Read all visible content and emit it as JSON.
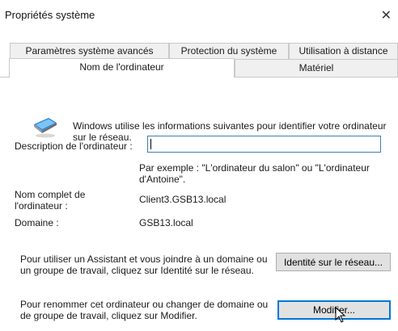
{
  "window": {
    "title": "Propriétés système",
    "close_glyph": "✕"
  },
  "tabs": {
    "row1": [
      "Paramètres système avancés",
      "Protection du système",
      "Utilisation à distance"
    ],
    "row2": [
      "Nom de l'ordinateur",
      "Matériel"
    ],
    "active": "Nom de l'ordinateur"
  },
  "intro_text": "Windows utilise les informations suivantes pour identifier votre ordinateur sur le réseau.",
  "description": {
    "label": "Description de l'ordinateur :",
    "value": "",
    "hint": "Par exemple : \"L'ordinateur du salon\" ou \"L'ordinateur d'Antoine\"."
  },
  "full_name": {
    "label": "Nom complet de l'ordinateur :",
    "value": "Client3.GSB13.local"
  },
  "domain": {
    "label": "Domaine :",
    "value": "GSB13.local"
  },
  "network_id": {
    "text": "Pour utiliser un Assistant et vous joindre à un domaine ou un groupe de travail, cliquez sur Identité sur le réseau.",
    "button_label": "Identité sur le réseau..."
  },
  "rename": {
    "text": "Pour renommer cet ordinateur ou changer de domaine ou de groupe de travail, cliquez sur Modifier.",
    "button_label": "Modifier..."
  },
  "icons": {
    "computer": "computer-icon",
    "close": "close-icon",
    "cursor": "mouse-pointer-icon"
  },
  "colors": {
    "input_border": "#3c7fb1",
    "focus_border": "#0078d7",
    "button_bg": "#e1e1e1",
    "tab_bg": "#f0f0f0"
  }
}
